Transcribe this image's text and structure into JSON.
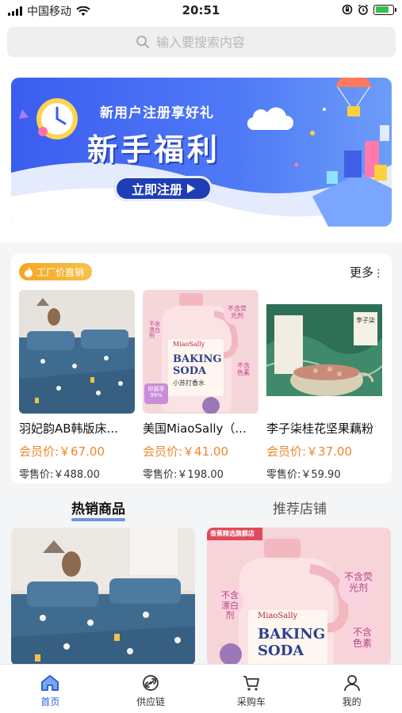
{
  "status_bar": {
    "carrier": "中国移动",
    "time": "20:51"
  },
  "search": {
    "placeholder": "输入要搜索内容"
  },
  "banner": {
    "subtitle": "新用户注册享好礼",
    "title": "新手福利",
    "button_label": "立即注册"
  },
  "factory": {
    "badge": "工厂价直销",
    "more": "更多",
    "products": [
      {
        "name": "羽妃韵AB韩版床...",
        "member_price": "会员价:￥67.00",
        "retail_price": "零售价:￥488.00"
      },
      {
        "name": "美国MiaoSally（...",
        "member_price": "会员价:￥41.00",
        "retail_price": "零售价:￥198.00"
      },
      {
        "name": "李子柒桂花坚果藕粉",
        "member_price": "会员价:￥37.00",
        "retail_price": "零售价:￥59.90"
      }
    ]
  },
  "tabs": {
    "hot": "热销商品",
    "stores": "推荐店铺"
  },
  "product_art": {
    "baking_soda_brand": "MiaoSally",
    "baking_soda_line1": "BAKING",
    "baking_soda_line2": "SODA",
    "baking_soda_cn": "小苏打香水",
    "tag_no_bleach": "不含漂白剂",
    "tag_no_fluor": "不含荧光剂",
    "tag_no_color": "不含色素",
    "tag_no_color_short": "不含色素",
    "antibacterial": "抑菌率99%",
    "store_banner": "香蕉精选旗舰店",
    "lizi_logo": "李子柒"
  },
  "tabbar": {
    "home": "首页",
    "supply": "供应链",
    "cart": "采购车",
    "mine": "我的"
  }
}
